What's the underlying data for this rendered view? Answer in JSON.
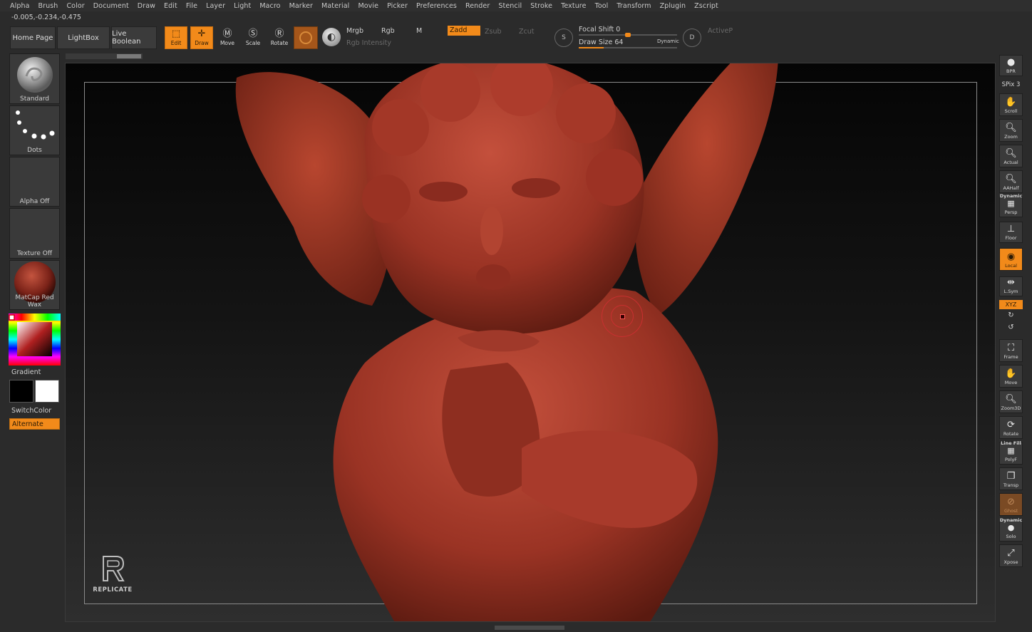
{
  "menu": [
    "Alpha",
    "Brush",
    "Color",
    "Document",
    "Draw",
    "Edit",
    "File",
    "Layer",
    "Light",
    "Macro",
    "Marker",
    "Material",
    "Movie",
    "Picker",
    "Preferences",
    "Render",
    "Stencil",
    "Stroke",
    "Texture",
    "Tool",
    "Transform",
    "Zplugin",
    "Zscript"
  ],
  "coords": "-0.005,-0.234,-0.475",
  "nav": {
    "home": "Home Page",
    "lightbox": "LightBox",
    "live_boolean": "Live Boolean"
  },
  "tools": {
    "edit": "Edit",
    "draw": "Draw",
    "move": "Move",
    "scale": "Scale",
    "rotate": "Rotate"
  },
  "color_modes": {
    "mrgb": "Mrgb",
    "rgb": "Rgb",
    "m": "M",
    "rgb_intensity": "Rgb Intensity"
  },
  "sculpt_modes": {
    "zadd": "Zadd",
    "zsub": "Zsub",
    "zcut": "Zcut"
  },
  "focal_shift": {
    "label": "Focal Shift",
    "value": "0",
    "level": 0.5
  },
  "draw_size": {
    "label": "Draw Size",
    "value": "64",
    "level": 0.25,
    "dynamic": "Dynamic"
  },
  "active_points": "ActiveP",
  "left": {
    "brush": "Standard",
    "stroke": "Dots",
    "alpha": "Alpha Off",
    "texture": "Texture Off",
    "material": "MatCap Red Wax",
    "gradient": "Gradient",
    "switch_color": "SwitchColor",
    "alternate": "Alternate"
  },
  "right": {
    "bpr": "BPR",
    "spix": "SPix 3",
    "scroll": "Scroll",
    "zoom": "Zoom",
    "actual": "Actual",
    "aahalf": "AAHalf",
    "dynamic": "Dynamic",
    "persp": "Persp",
    "floor": "Floor",
    "local": "Local",
    "lsym": "L.Sym",
    "xyz": "XYZ",
    "frame": "Frame",
    "move": "Move",
    "zoom3d": "Zoom3D",
    "rotate": "Rotate",
    "linefill": "Line Fill",
    "polyf": "PolyF",
    "transp": "Transp",
    "ghost": "Ghost",
    "dynamic2": "Dynamic",
    "solo": "Solo",
    "xpose": "Xpose"
  },
  "logo_text": "REPLICATE",
  "colors": {
    "accent": "#f28a1a",
    "wax": "#a83a2e",
    "cursor": "#c83030"
  }
}
